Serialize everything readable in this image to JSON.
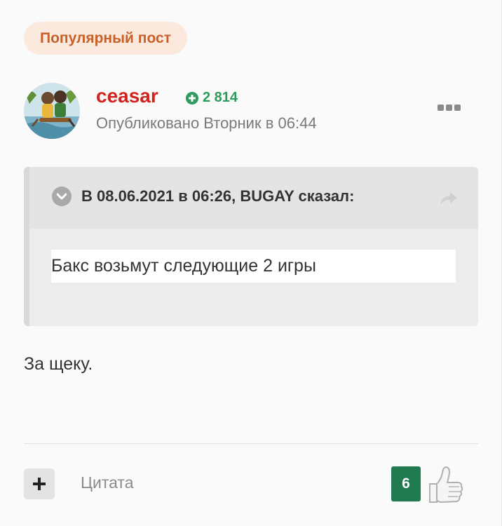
{
  "badge": {
    "label": "Популярный пост"
  },
  "author": {
    "name": "ceasar",
    "reputation": "2 814",
    "published": "Опубликовано Вторник в 06:44"
  },
  "quote": {
    "citation": "В 08.06.2021 в 06:26, BUGAY сказал:",
    "text": "Бакс возьмут следующие 2 игры"
  },
  "post": {
    "text": "За щеку."
  },
  "footer": {
    "quote_label": "Цитата",
    "like_count": "6"
  },
  "colors": {
    "author": "#d1231d",
    "reputation": "#2e9a5b",
    "badge_text": "#c6612a",
    "badge_bg": "#fbe9dd",
    "like_bg": "#1f7a50"
  }
}
